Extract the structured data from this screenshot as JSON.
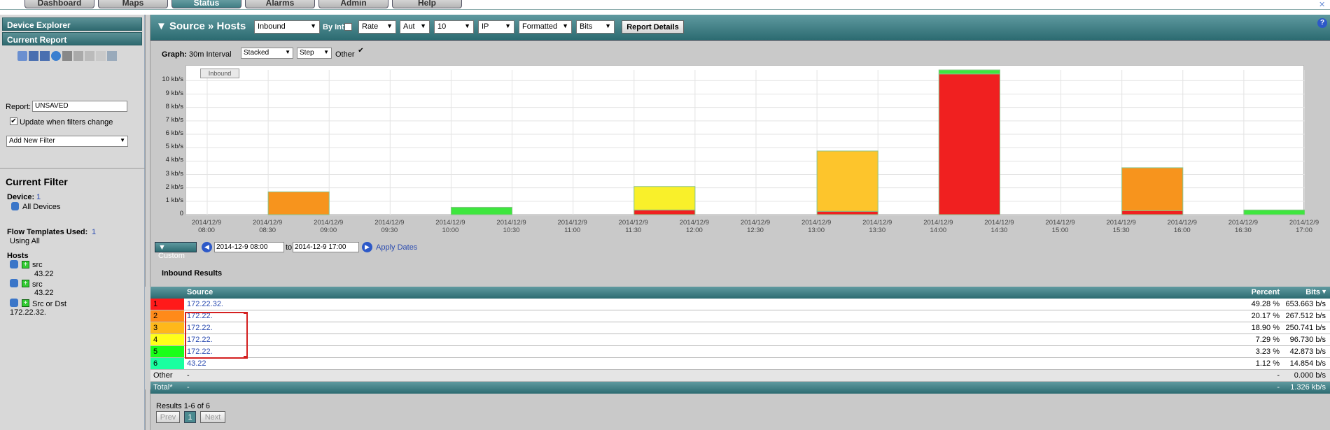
{
  "tabs": [
    "Dashboard",
    "Maps",
    "Status",
    "Alarms",
    "Admin",
    "Help"
  ],
  "left": {
    "device_explorer": "Device Explorer",
    "current_report": "Current Report",
    "report_label": "Report:",
    "report_value": "UNSAVED",
    "update_label": "Update when filters change",
    "add_filter": "Add New Filter",
    "current_filter": "Current Filter",
    "device_label": "Device:",
    "device_count": "1",
    "all_devices": "All Devices",
    "flow_label": "Flow Templates Used:",
    "flow_count": "1",
    "using_all": "Using All",
    "hosts_label": "Hosts",
    "hosts": [
      {
        "type": "src",
        "value": "43.22"
      },
      {
        "type": "src",
        "value": "43.22"
      },
      {
        "type": "Src or Dst",
        "value": "172.22.32."
      }
    ]
  },
  "toolbar": {
    "title": "▼ Source » Hosts",
    "direction": "Inbound",
    "by_int": "By Int",
    "rate": "Rate",
    "aut": "Aut",
    "count": "10",
    "ip": "IP",
    "formatted": "Formatted",
    "bits": "Bits",
    "report_details": "Report Details",
    "help": "?"
  },
  "graph": {
    "label": "Graph:",
    "interval": "30m Interval",
    "stacked": "Stacked",
    "step": "Step",
    "other": "Other",
    "legend_tag": "Inbound"
  },
  "chart_data": {
    "type": "bar",
    "stacked": true,
    "y_ticks": [
      "0",
      "1 kb/s",
      "2 kb/s",
      "3 kb/s",
      "4 kb/s",
      "5 kb/s",
      "6 kb/s",
      "7 kb/s",
      "8 kb/s",
      "9 kb/s",
      "10 kb/s"
    ],
    "ylim": [
      0,
      10.8
    ],
    "x_ticks": [
      [
        "2014/12/9",
        "08:00"
      ],
      [
        "2014/12/9",
        "08:30"
      ],
      [
        "2014/12/9",
        "09:00"
      ],
      [
        "2014/12/9",
        "09:30"
      ],
      [
        "2014/12/9",
        "10:00"
      ],
      [
        "2014/12/9",
        "10:30"
      ],
      [
        "2014/12/9",
        "11:00"
      ],
      [
        "2014/12/9",
        "11:30"
      ],
      [
        "2014/12/9",
        "12:00"
      ],
      [
        "2014/12/9",
        "12:30"
      ],
      [
        "2014/12/9",
        "13:00"
      ],
      [
        "2014/12/9",
        "13:30"
      ],
      [
        "2014/12/9",
        "14:00"
      ],
      [
        "2014/12/9",
        "14:30"
      ],
      [
        "2014/12/9",
        "15:00"
      ],
      [
        "2014/12/9",
        "15:30"
      ],
      [
        "2014/12/9",
        "16:00"
      ],
      [
        "2014/12/9",
        "16:30"
      ],
      [
        "2014/12/9",
        "17:00"
      ]
    ],
    "bars": [
      {
        "slot": 1,
        "segments": [
          {
            "color": "#f7941d",
            "value": 1.7
          }
        ]
      },
      {
        "slot": 4,
        "segments": [
          {
            "color": "#3ee63e",
            "value": 0.55
          }
        ]
      },
      {
        "slot": 7,
        "segments": [
          {
            "color": "#f02020",
            "value": 0.35
          },
          {
            "color": "#f9f02a",
            "value": 1.75
          }
        ]
      },
      {
        "slot": 10,
        "segments": [
          {
            "color": "#f02020",
            "value": 0.25
          },
          {
            "color": "#fdc52c",
            "value": 4.5
          }
        ]
      },
      {
        "slot": 12,
        "segments": [
          {
            "color": "#f02020",
            "value": 10.5
          },
          {
            "color": "#3ee63e",
            "value": 0.3
          }
        ]
      },
      {
        "slot": 15,
        "segments": [
          {
            "color": "#f02020",
            "value": 0.3
          },
          {
            "color": "#f7941d",
            "value": 3.2
          }
        ]
      },
      {
        "slot": 17,
        "segments": [
          {
            "color": "#3ee63e",
            "value": 0.35
          }
        ]
      }
    ]
  },
  "date_range": {
    "custom": "▼ Custom",
    "from": "2014-12-9 08:00",
    "to_label": "to",
    "to": "2014-12-9 17:00",
    "apply": "Apply Dates"
  },
  "results": {
    "title": "Inbound Results",
    "col_source": "Source",
    "col_percent": "Percent",
    "col_bits": "Bits",
    "rows": [
      {
        "idx": "1",
        "color": "#ff1a1a",
        "source": "172.22.32.",
        "percent": "49.28 %",
        "bits": "653.663 b/s"
      },
      {
        "idx": "2",
        "color": "#ff8a1a",
        "source": "172.22.",
        "percent": "20.17 %",
        "bits": "267.512 b/s"
      },
      {
        "idx": "3",
        "color": "#ffb81a",
        "source": "172.22.",
        "percent": "18.90 %",
        "bits": "250.741 b/s"
      },
      {
        "idx": "4",
        "color": "#ffff1a",
        "source": "172.22.",
        "percent": "7.29 %",
        "bits": "96.730 b/s"
      },
      {
        "idx": "5",
        "color": "#1aff1a",
        "source": "172.22.",
        "percent": "3.23 %",
        "bits": "42.873 b/s"
      },
      {
        "idx": "6",
        "color": "#1affa0",
        "source": "43.22",
        "percent": "1.12 %",
        "bits": "14.854 b/s"
      }
    ],
    "other_label": "Other",
    "other_source": "-",
    "other_percent": "-",
    "other_bits": "0.000 b/s",
    "total_label": "Total*",
    "total_source": "-",
    "total_percent": "-",
    "total_bits": "1.326 kb/s",
    "summary": "Results 1-6 of 6",
    "prev": "Prev",
    "page": "1",
    "next": "Next"
  }
}
